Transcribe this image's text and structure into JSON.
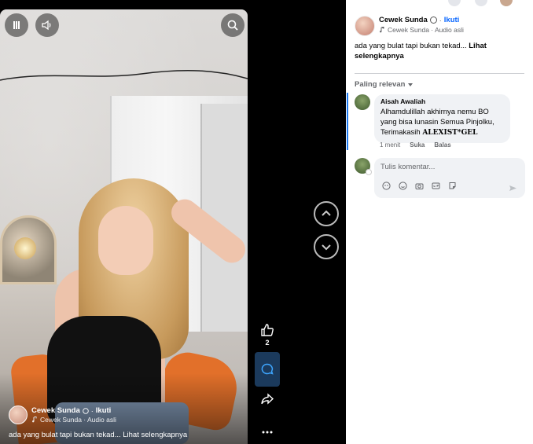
{
  "video": {
    "author": "Cewek Sunda",
    "follow_label": "Ikuti",
    "audio": "Cewek Sunda · Audio asli",
    "caption": "ada yang bulat tapi bukan tekad...",
    "see_more": "Lihat selengkapnya"
  },
  "controls": {
    "pause_icon": "pause-icon",
    "volume_icon": "volume-icon",
    "search_icon": "search-icon"
  },
  "actions": {
    "like_count": "2",
    "more_label": "..."
  },
  "post": {
    "author": "Cewek Sunda",
    "separator": "·",
    "follow_label": "Ikuti",
    "audio": "Cewek Sunda · Audio asli",
    "caption": "ada yang bulat tapi bukan tekad...",
    "see_more": "Lihat selengkapnya"
  },
  "comments": {
    "sort_label": "Paling relevan",
    "items": [
      {
        "author": "Aisah Awaliah",
        "text": "Alhamdulillah akhirnya nemu BO yang bisa lunasin Semua Pinjolku, Terimakasih",
        "highlight": "ALEXIST*GEL",
        "time": "1 menit",
        "like_label": "Suka",
        "reply_label": "Balas"
      }
    ],
    "composer_placeholder": "Tulis komentar..."
  },
  "colors": {
    "accent": "#0866ff",
    "active_action_bg": "#1b3a5c",
    "chair": "#e2702a"
  }
}
